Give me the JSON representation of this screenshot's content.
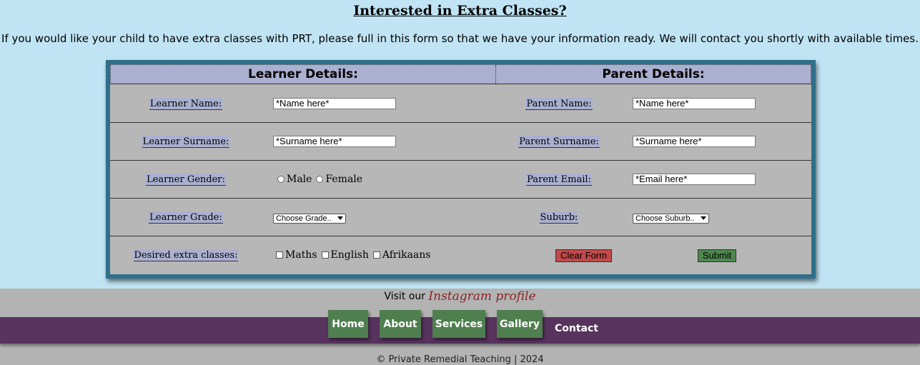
{
  "page": {
    "title": "Interested in Extra Classes?",
    "intro": "If you would like your child to have extra classes with PRT, please full in this form so that we have your information ready. We will contact you shortly with available times."
  },
  "form": {
    "learner_header": "Learner Details:",
    "parent_header": "Parent Details:",
    "learner_name_label": "Learner Name:",
    "learner_name_value": "*Name here*",
    "learner_surname_label": "Learner Surname:",
    "learner_surname_value": "*Surname here*",
    "learner_gender_label": "Learner Gender:",
    "gender_options": [
      "Male",
      "Female"
    ],
    "learner_grade_label": "Learner Grade:",
    "grade_select": "Choose Grade..",
    "desired_classes_label": "Desired extra classes:",
    "class_options": [
      "Maths",
      "English",
      "Afrikaans"
    ],
    "parent_name_label": "Parent Name:",
    "parent_name_value": "*Name here*",
    "parent_surname_label": "Parent Surname:",
    "parent_surname_value": "*Surname here*",
    "parent_email_label": "Parent Email:",
    "parent_email_value": "*Email here*",
    "suburb_label": "Suburb:",
    "suburb_select": "Choose Suburb..",
    "clear_button": "Clear Form",
    "submit_button": "Submit"
  },
  "footer": {
    "visit_prefix": "Visit our",
    "instagram_link": "Instagram profile",
    "nav": [
      "Home",
      "About",
      "Services",
      "Gallery",
      "Contact"
    ],
    "copyright": "© Private Remedial Teaching | 2024"
  },
  "colors": {
    "page_bg": "#c0e4f4",
    "form_border": "#2e6f8a",
    "header_band": "#abb0d0",
    "nav_bar": "#57335e",
    "nav_button": "#4f7f4f",
    "clear_button": "#c04a4a",
    "submit_button": "#4f874f",
    "instagram_link": "#8b2424"
  }
}
